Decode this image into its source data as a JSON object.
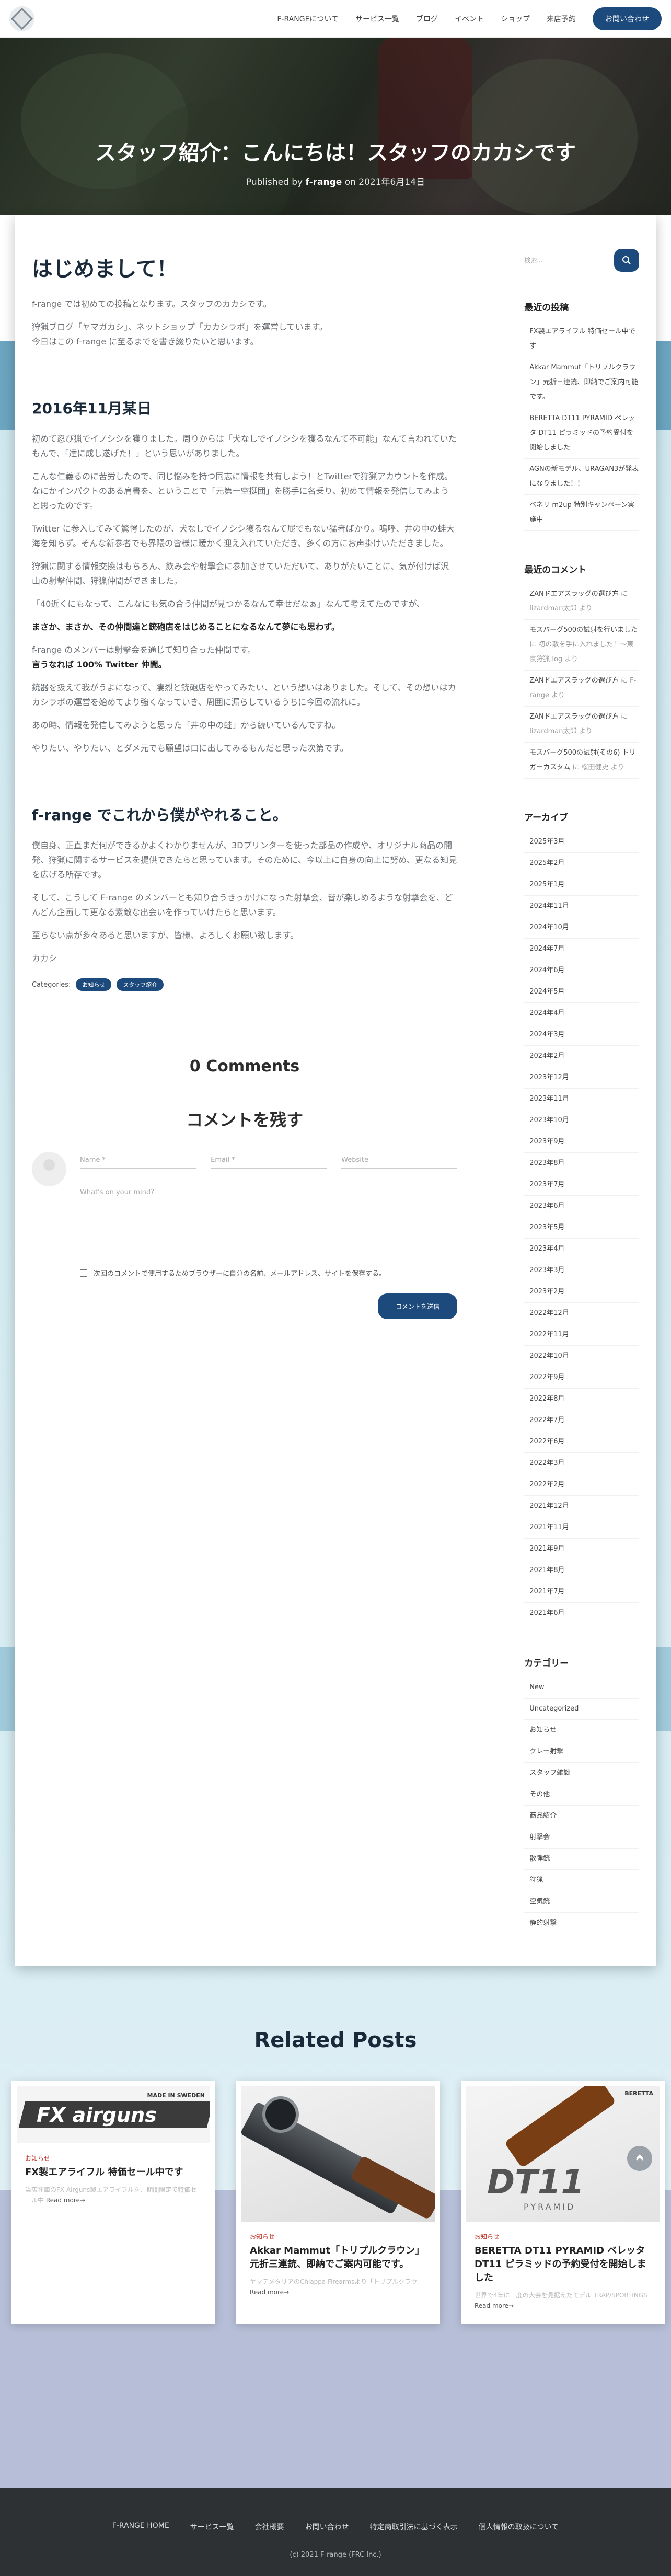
{
  "header": {
    "nav": [
      "F-RANGEについて",
      "サービス一覧",
      "ブログ",
      "イベント",
      "ショップ",
      "来店予約"
    ],
    "contact_button": "お問い合わせ"
  },
  "hero": {
    "title": "スタッフ紹介：こんにちは！スタッフのカカシです",
    "meta_prefix": "Published by",
    "author": "f-range",
    "meta_on": "on",
    "date": "2021年6月14日"
  },
  "post": {
    "heading1": "はじめまして！",
    "p1": "f-range では初めての投稿となります。スタッフのカカシです。",
    "p2a": "狩猟ブログ「ヤマガカシ」、ネットショップ「カカシラボ」を運営しています。",
    "p2b": "今日はこの f-range に至るまでを書き綴りたいと思います。",
    "heading2": "2016年11月某日",
    "p3": "初めて忍び猟でイノシシを獲りました。周りからは「犬なしでイノシシを獲るなんて不可能」なんて言われていたもんで、「達に成し遂げた！」という思いがありました。",
    "p4": "こんな仁義るのに苦労したので、同じ悩みを持つ同志に情報を共有しよう！とTwitterで狩猟アカウントを作成。なにかインパクトのある肩書を、ということで「元第一空挺団」を勝手に名乗り、初めて情報を発信してみようと思ったのです。",
    "p5": "Twitter に参入してみて驚愕したのが、犬なしでイノシシ獲るなんて屁でもない猛者ばかり。嗚呼、井の中の蛙大海を知らず。そんな新参者でも界隈の皆様に暖かく迎え入れていただき、多くの方にお声掛けいただきました。",
    "p6": "狩猟に関する情報交換はもちろん、飲み会や射撃会に参加させていただいて、ありがたいことに、気が付けば沢山の射撃仲間、狩猟仲間ができました。",
    "p7": "「40近くにもなって、こんなにも気の合う仲間が見つかるなんて幸せだなぁ」なんて考えてたのですが、",
    "p8": "まさか、まさか、その仲間達と銃砲店をはじめることになるなんて夢にも思わず。",
    "p9a": "f-range のメンバーは射撃会を通じて知り合った仲間です。",
    "p9b": "言うなれば 100% Twitter 仲間。",
    "p10": "銃器を扱えて我がうよになって、凄烈と銃砲店をやってみたい、という想いはありました。そして、その想いはカカシラボの運営を始めてより強くなっていき、周囲に漏らしているうちに今回の流れに。",
    "p11": "あの時、情報を発信してみようと思った「井の中の蛙」から続いているんですね。",
    "p12": "やりたい、やりたい、とダメ元でも願望は口に出してみるもんだと思った次第です。",
    "heading3": "f-range でこれから僕がやれること。",
    "p13": "僕自身、正直まだ何ができるかよくわかりませんが、3Dプリンターを使った部品の作成や、オリジナル商品の開発、狩猟に関するサービスを提供できたらと思っています。そのために、今以上に自身の向上に努め、更なる知見を広げる所存です。",
    "p14": "そして、こうして F-range のメンバーとも知り合うきっかけになった射撃会、皆が楽しめるような射撃会を、どんどん企画して更なる素敵な出会いを作っていけたらと思います。",
    "p15": "至らない点が多々あると思いますが、皆様、よろしくお願い致します。",
    "p16": "カカシ",
    "categories_label": "Categories:",
    "categories": [
      "お知らせ",
      "スタッフ紹介"
    ]
  },
  "comments": {
    "count": "0 Comments",
    "title": "コメントを残す",
    "name_placeholder": "Name *",
    "email_placeholder": "Email *",
    "website_placeholder": "Website",
    "message_placeholder": "What's on your mind?",
    "save_label": "次回のコメントで使用するためブラウザーに自分の名前、メールアドレス、サイトを保存する。",
    "submit": "コメントを送信"
  },
  "sidebar": {
    "search_placeholder": "検索...",
    "recent_posts_title": "最近の投稿",
    "recent_posts": [
      "FX製エアライフル 特価セール中です",
      "Akkar Mammut「トリプルクラウン」元折三連銃、即納でご案内可能です。",
      "BERETTA DT11 PYRAMID ベレッタ DT11 ピラミッドの予約受付を開始しました",
      "AGNの新モデル、URAGAN3が発表になりました！！",
      "ベネリ m2up 特別キャンペーン実施中"
    ],
    "recent_comments_title": "最近のコメント",
    "recent_comments": [
      {
        "post": "ZANドエアスラッグの選び方",
        "by": "に lizardman太郎 より"
      },
      {
        "post": "モスバーグ500の試射を行いました",
        "by": "に 初の散を手に入れました！～東京狩猟.log より"
      },
      {
        "post": "ZANドエアスラッグの選び方",
        "by": "に F-range より"
      },
      {
        "post": "ZANドエアスラッグの選び方",
        "by": "に lizardman太郎 より"
      },
      {
        "post": "モスバーグ500の試射(その6) トリガーカスタム",
        "by": "に 桜田健史 より"
      }
    ],
    "archive_title": "アーカイブ",
    "archives": [
      "2025年3月",
      "2025年2月",
      "2025年1月",
      "2024年11月",
      "2024年10月",
      "2024年7月",
      "2024年6月",
      "2024年5月",
      "2024年4月",
      "2024年3月",
      "2024年2月",
      "2023年12月",
      "2023年11月",
      "2023年10月",
      "2023年9月",
      "2023年8月",
      "2023年7月",
      "2023年6月",
      "2023年5月",
      "2023年4月",
      "2023年3月",
      "2023年2月",
      "2022年12月",
      "2022年11月",
      "2022年10月",
      "2022年9月",
      "2022年8月",
      "2022年7月",
      "2022年6月",
      "2022年3月",
      "2022年2月",
      "2021年12月",
      "2021年11月",
      "2021年9月",
      "2021年8月",
      "2021年7月",
      "2021年6月"
    ],
    "category_title": "カテゴリー",
    "categories": [
      "New",
      "Uncategorized",
      "お知らせ",
      "クレー射撃",
      "スタッフ雑談",
      "その他",
      "商品紹介",
      "射撃会",
      "散弾銃",
      "狩猟",
      "空気銃",
      "静的射撃"
    ]
  },
  "related": {
    "title": "Related Posts",
    "cards": [
      {
        "category": "お知らせ",
        "title": "FX製エアライフル 特価セール中です",
        "excerpt": "当店在庫のFX Airguns製エアライフルを、期間限定で特価セール中",
        "more": "Read more→",
        "image_text": "FX airguns",
        "image_sub": "MADE IN SWEDEN"
      },
      {
        "category": "お知らせ",
        "title": "Akkar Mammut「トリプルクラウン」元折三連銃、即納でご案内可能です。",
        "excerpt": "ヤマテメタリアのChiappa Firearmsより「トリプルクラウ",
        "more": "Read more→"
      },
      {
        "category": "お知らせ",
        "title": "BERETTA DT11 PYRAMID ベレッタ DT11 ピラミッドの予約受付を開始しました",
        "excerpt": "世界で4年に一度の大会を見据えたモデル TRAP/SPORTINGS",
        "more": "Read more→",
        "image_text": "DT11",
        "image_sub": "PYRAMID",
        "image_brand": "BERETTA"
      }
    ]
  },
  "footer": {
    "links": [
      "F-RANGE HOME",
      "サービス一覧",
      "会社概要",
      "お問い合わせ",
      "特定商取引法に基づく表示",
      "個人情報の取扱について"
    ],
    "copyright": "(c) 2021 F-range (FRC Inc.)"
  },
  "colors": {
    "accent": "#1d4a7c",
    "footer": "#2e3134",
    "category_red": "#c0392b"
  }
}
